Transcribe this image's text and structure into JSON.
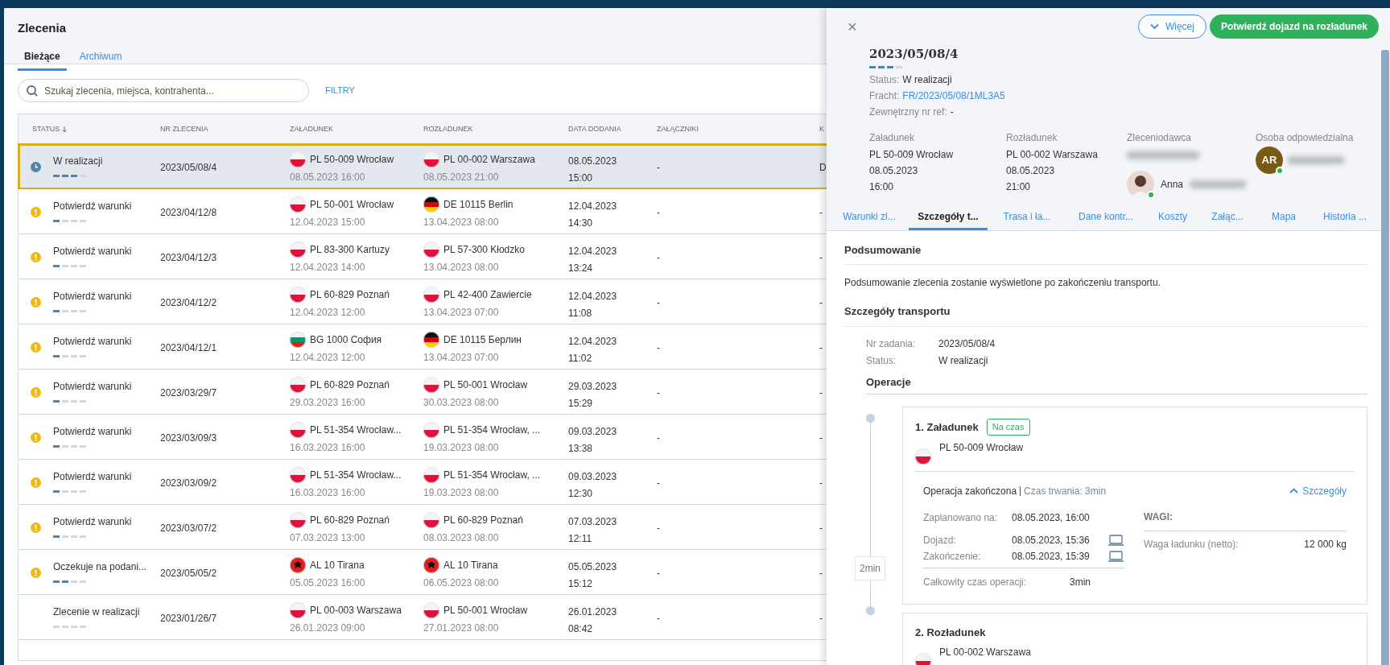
{
  "page": {
    "title": "Zlecenia"
  },
  "tabs": [
    {
      "label": "Bieżące",
      "selected": true
    },
    {
      "label": "Archiwum",
      "selected": false
    }
  ],
  "search": {
    "placeholder": "Szukaj zlecenia, miejsca, kontrahenta..."
  },
  "filter_button": "FILTRY",
  "table": {
    "columns": [
      {
        "label": "STATUS",
        "sorted": true
      },
      {
        "label": "NR ZLECENIA",
        "sorted": false
      },
      {
        "label": "ZAŁADUNEK",
        "sorted": false
      },
      {
        "label": "ROZŁADUNEK",
        "sorted": false
      },
      {
        "label": "DATA DODANIA",
        "sorted": false
      },
      {
        "label": "ZAŁĄCZNIKI",
        "sorted": false
      },
      {
        "label": "K",
        "sorted": false
      }
    ],
    "rows": [
      {
        "selected": true,
        "kind": "clock",
        "status": "W realizacji",
        "level": 0.75,
        "number": "2023/05/08/4",
        "loading": {
          "kind": "pl",
          "place": "PL 50-009 Wrocław",
          "time": "08.05.2023 16:00"
        },
        "unloading": {
          "kind": "pl",
          "place": "PL 00-002 Warszawa",
          "time": "08.05.2023 21:00"
        },
        "date": "08.05.2023",
        "hour": "15:00",
        "attachments": "-",
        "column_7": "D"
      },
      {
        "selected": false,
        "kind": "warning",
        "status": "Potwierdź warunki",
        "level": 0.25,
        "number": "2023/04/12/8",
        "loading": {
          "kind": "pl",
          "place": "PL 50-001 Wrocław",
          "time": "12.04.2023 15:00"
        },
        "unloading": {
          "kind": "de",
          "place": "DE 10115 Berlin",
          "time": "13.04.2023 08:00"
        },
        "date": "12.04.2023",
        "hour": "14:30",
        "attachments": "-",
        "column_7": "-"
      },
      {
        "selected": false,
        "kind": "warning",
        "status": "Potwierdź warunki",
        "level": 0.25,
        "number": "2023/04/12/3",
        "loading": {
          "kind": "pl",
          "place": "PL 83-300 Kartuzy",
          "time": "12.04.2023 14:00"
        },
        "unloading": {
          "kind": "pl",
          "place": "PL 57-300 Kłodzko",
          "time": "13.04.2023 08:00"
        },
        "date": "12.04.2023",
        "hour": "13:24",
        "attachments": "-",
        "column_7": "-"
      },
      {
        "selected": false,
        "kind": "warning",
        "status": "Potwierdź warunki",
        "level": 0.25,
        "number": "2023/04/12/2",
        "loading": {
          "kind": "pl",
          "place": "PL 60-829 Poznań",
          "time": "12.04.2023 12:00"
        },
        "unloading": {
          "kind": "pl",
          "place": "PL 42-400 Zawiercie",
          "time": "13.04.2023 07:00"
        },
        "date": "12.04.2023",
        "hour": "11:08",
        "attachments": "-",
        "column_7": "-"
      },
      {
        "selected": false,
        "kind": "warning",
        "status": "Potwierdź warunki",
        "level": 0.25,
        "number": "2023/04/12/1",
        "loading": {
          "kind": "bg",
          "place": "BG 1000 София",
          "time": "12.04.2023 12:00"
        },
        "unloading": {
          "kind": "de",
          "place": "DE 10115 Берлин",
          "time": "13.04.2023 07:00"
        },
        "date": "12.04.2023",
        "hour": "11:02",
        "attachments": "-",
        "column_7": "-"
      },
      {
        "selected": false,
        "kind": "warning",
        "status": "Potwierdź warunki",
        "level": 0.25,
        "number": "2023/03/29/7",
        "loading": {
          "kind": "pl",
          "place": "PL 60-829 Poznań",
          "time": "29.03.2023 16:00"
        },
        "unloading": {
          "kind": "pl",
          "place": "PL 50-001 Wrocław",
          "time": "30.03.2023 08:00"
        },
        "date": "29.03.2023",
        "hour": "15:29",
        "attachments": "-",
        "column_7": "-"
      },
      {
        "selected": false,
        "kind": "warning",
        "status": "Potwierdź warunki",
        "level": 0.25,
        "number": "2023/03/09/3",
        "loading": {
          "kind": "pl",
          "place": "PL 51-354 Wrocław...",
          "time": "16.03.2023 16:00"
        },
        "unloading": {
          "kind": "pl",
          "place": "PL 51-354 Wrocław, ...",
          "time": "19.03.2023 08:00"
        },
        "date": "09.03.2023",
        "hour": "13:38",
        "attachments": "-",
        "column_7": "-"
      },
      {
        "selected": false,
        "kind": "warning",
        "status": "Potwierdź warunki",
        "level": 0.25,
        "number": "2023/03/09/2",
        "loading": {
          "kind": "pl",
          "place": "PL 51-354 Wrocław...",
          "time": "16.03.2023 16:00"
        },
        "unloading": {
          "kind": "pl",
          "place": "PL 51-354 Wrocław, ...",
          "time": "19.03.2023 08:00"
        },
        "date": "09.03.2023",
        "hour": "12:30",
        "attachments": "-",
        "column_7": "-"
      },
      {
        "selected": false,
        "kind": "warning",
        "status": "Potwierdź warunki",
        "level": 0.25,
        "number": "2023/03/07/2",
        "loading": {
          "kind": "pl",
          "place": "PL 60-829 Poznań",
          "time": "07.03.2023 13:00"
        },
        "unloading": {
          "kind": "pl",
          "place": "PL 60-829 Poznań",
          "time": "08.03.2023 08:00"
        },
        "date": "07.03.2023",
        "hour": "12:11",
        "attachments": "-",
        "column_7": "-"
      },
      {
        "selected": false,
        "kind": "warning",
        "status": "Oczekuje na podani...",
        "level": 0.5,
        "number": "2023/05/05/2",
        "loading": {
          "kind": "al",
          "place": "AL 10 Tirana",
          "time": "05.05.2023 16:00"
        },
        "unloading": {
          "kind": "al",
          "place": "AL 10 Tirana",
          "time": "06.05.2023 08:00"
        },
        "date": "05.05.2023",
        "hour": "15:12",
        "attachments": "-",
        "column_7": "-"
      },
      {
        "selected": false,
        "kind": "none",
        "status": "Zlecenie w realizacji",
        "level": 0,
        "number": "2023/01/26/7",
        "loading": {
          "kind": "pl",
          "place": "PL 00-003 Warszawa",
          "time": "26.01.2023 09:00"
        },
        "unloading": {
          "kind": "pl",
          "place": "PL 50-001 Wrocław",
          "time": "27.01.2023 08:00"
        },
        "date": "26.01.2023",
        "hour": "08:42",
        "attachments": "-",
        "column_7": "-"
      }
    ]
  },
  "detail": {
    "close": "×",
    "more_button": "Więcej",
    "confirm_button": "Potwierdź dojazd na rozładunek",
    "title": "2023/05/08/4",
    "level": 0.75,
    "meta": [
      {
        "label": "Status:",
        "value": "W realizacji",
        "link": false
      },
      {
        "label": "Fracht:",
        "value": "FR/2023/05/08/1ML3A5",
        "link": true
      },
      {
        "label": "Zewnętrzny nr ref:",
        "value": "-",
        "link": false
      }
    ],
    "loading": {
      "label": "Załadunek",
      "lines": [
        "PL 50-009 Wrocław",
        "08.05.2023",
        "16:00"
      ]
    },
    "unloading": {
      "label": "Rozładunek",
      "lines": [
        "PL 00-002 Warszawa",
        "08.05.2023",
        "21:00"
      ]
    },
    "client": {
      "label": "Zleceniodawca",
      "contact": "Anna",
      "online": true
    },
    "responsible": {
      "label": "Osoba odpowiedzialna",
      "initials": "AR",
      "online": true
    },
    "tabs": [
      {
        "label": "Warunki zl...",
        "selected": false
      },
      {
        "label": "Szczegóły t...",
        "selected": true
      },
      {
        "label": "Trasa i ła...",
        "selected": false
      },
      {
        "label": "Dane kontr...",
        "selected": false
      },
      {
        "label": "Koszty",
        "selected": false
      },
      {
        "label": "Załąc...",
        "selected": false
      },
      {
        "label": "Mapa",
        "selected": false
      },
      {
        "label": "Historia ...",
        "selected": false
      }
    ],
    "summary": {
      "heading": "Podsumowanie",
      "text": "Podsumowanie zlecenia zostanie wyświetlone po zakończeniu transportu."
    },
    "transport": {
      "heading": "Szczegóły transportu",
      "fields": [
        {
          "label": "Nr zadania:",
          "value": "2023/05/08/4"
        },
        {
          "label": "Status:",
          "value": "W realizacji"
        }
      ],
      "operations_heading": "Operacje",
      "gap": "2min",
      "operations": [
        {
          "title": "1. Załadunek",
          "badge": "Na czas",
          "kind": "pl",
          "place": "PL 50-009 Wrocław",
          "expanded": true,
          "state": "Operacja zakończona",
          "duration": "Czas trwania: 3min",
          "toggle": "Szczegóły",
          "times": [
            {
              "label": "Zaplanowano na:",
              "value": "08.05.2023, 16:00",
              "device": false
            },
            {
              "label": "Dojazd:",
              "value": "08.05.2023, 15:36",
              "device": true
            },
            {
              "label": "Zakończenie:",
              "value": "08.05.2023, 15:39",
              "device": true
            }
          ],
          "total": {
            "label": "Całkowity czas operacji:",
            "value": "3min"
          },
          "weights": {
            "heading": "WAGI:",
            "label": "Waga ładunku (netto):",
            "value": "12 000 kg"
          }
        },
        {
          "title": "2. Rozładunek",
          "kind": "pl",
          "place": "PL 00-002 Warszawa",
          "expanded": false
        }
      ]
    }
  }
}
